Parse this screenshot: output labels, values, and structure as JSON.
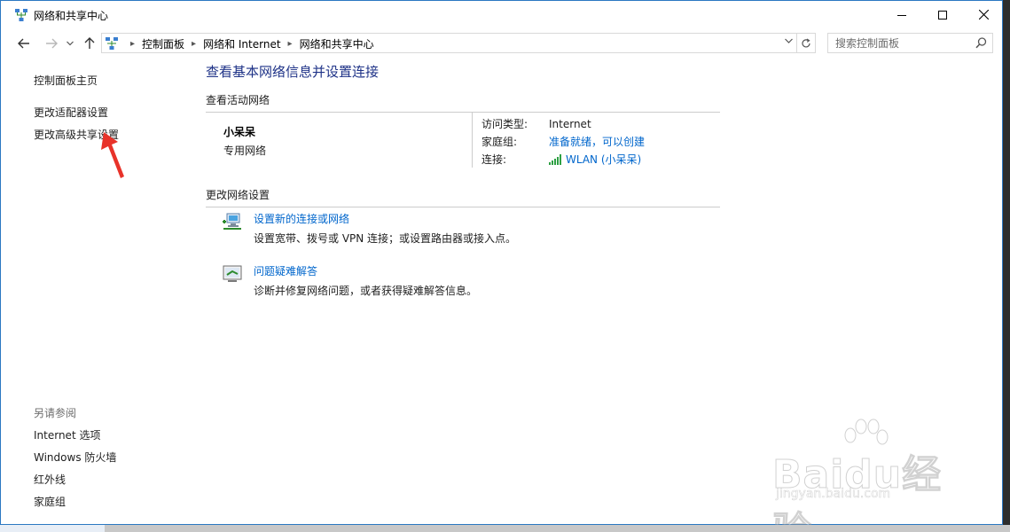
{
  "window": {
    "title": "网络和共享中心"
  },
  "address_bar": {
    "breadcrumbs": [
      "控制面板",
      "网络和 Internet",
      "网络和共享中心"
    ]
  },
  "search": {
    "placeholder": "搜索控制面板"
  },
  "left_pane": {
    "home": "控制面板主页",
    "change_adapter": "更改适配器设置",
    "change_advanced_sharing": "更改高级共享设置",
    "see_also_header": "另请参阅",
    "see_also": [
      "Internet 选项",
      "Windows 防火墙",
      "红外线",
      "家庭组"
    ]
  },
  "main": {
    "title": "查看基本网络信息并设置连接",
    "active_networks_header": "查看活动网络",
    "network": {
      "name": "小呆呆",
      "type": "专用网络",
      "access_type_label": "访问类型:",
      "access_type_value": "Internet",
      "homegroup_label": "家庭组:",
      "homegroup_value": "准备就绪，可以创建",
      "connections_label": "连接:",
      "connections_value": "WLAN (小呆呆)"
    },
    "change_settings_header": "更改网络设置",
    "tasks": [
      {
        "link": "设置新的连接或网络",
        "desc": "设置宽带、拨号或 VPN 连接；或设置路由器或接入点。",
        "icon": "new-connection-icon"
      },
      {
        "link": "问题疑难解答",
        "desc": "诊断并修复网络问题，或者获得疑难解答信息。",
        "icon": "troubleshoot-icon"
      }
    ]
  },
  "watermark": {
    "brand": "Baidu经验",
    "url": "jingyan.baidu.com"
  },
  "colors": {
    "link": "#0066cc",
    "title": "#1e3287",
    "annotation_arrow": "#e8332a"
  }
}
